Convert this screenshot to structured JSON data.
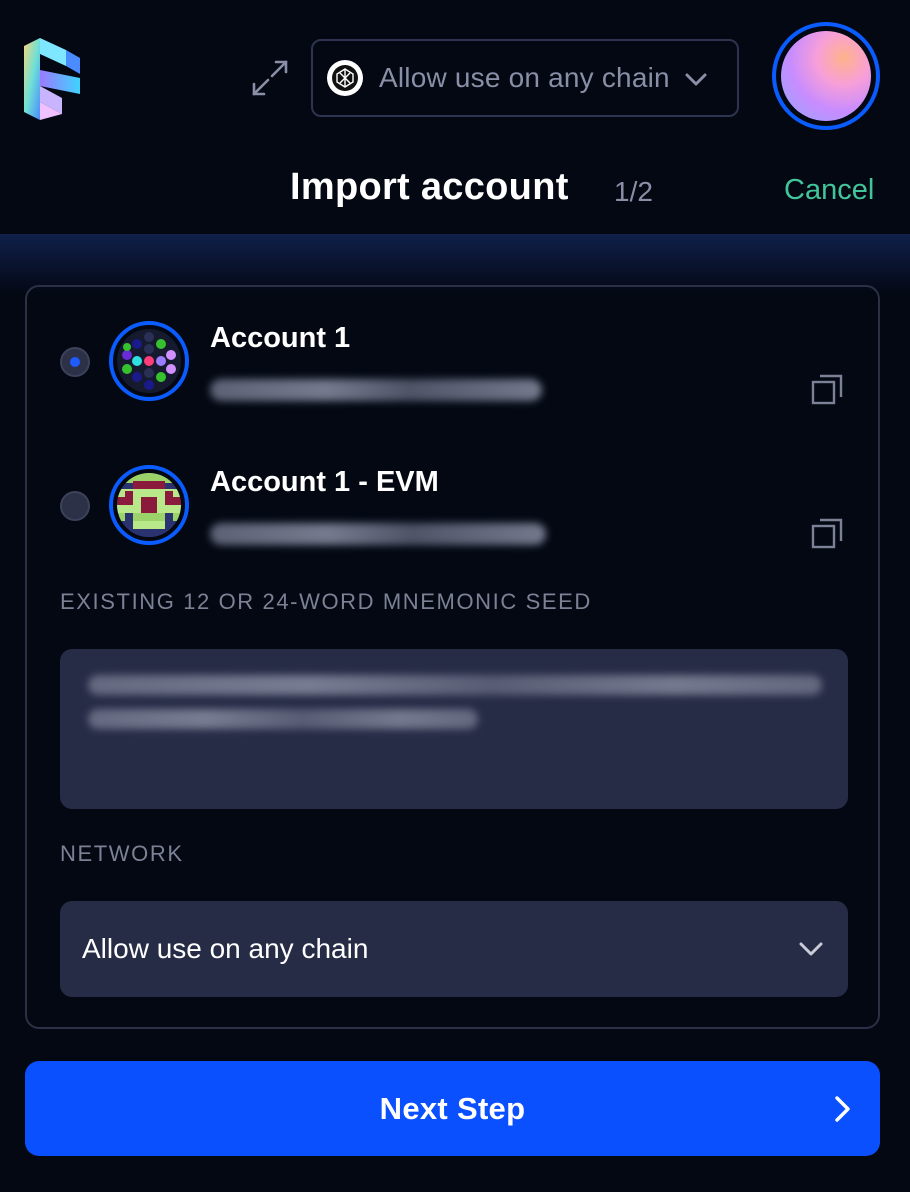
{
  "header": {
    "chain_selector_label": "Allow use on any chain",
    "title": "Import account",
    "step": "1/2",
    "cancel_label": "Cancel"
  },
  "accounts": [
    {
      "name": "Account 1",
      "selected": true
    },
    {
      "name": "Account 1 - EVM",
      "selected": false
    }
  ],
  "seed": {
    "label": "EXISTING 12 OR 24-WORD MNEMONIC SEED"
  },
  "network": {
    "label": "NETWORK",
    "selected": "Allow use on any chain"
  },
  "footer": {
    "next_label": "Next Step"
  },
  "colors": {
    "background": "#030813",
    "accent": "#0a50ff",
    "cancel": "#42c59a",
    "input_bg": "#272c46",
    "card_border": "#2b3046"
  },
  "icons": [
    "app-logo-icon",
    "expand-icon",
    "chain-icon",
    "chevron-down-icon",
    "copy-icon",
    "chevron-right-icon"
  ]
}
